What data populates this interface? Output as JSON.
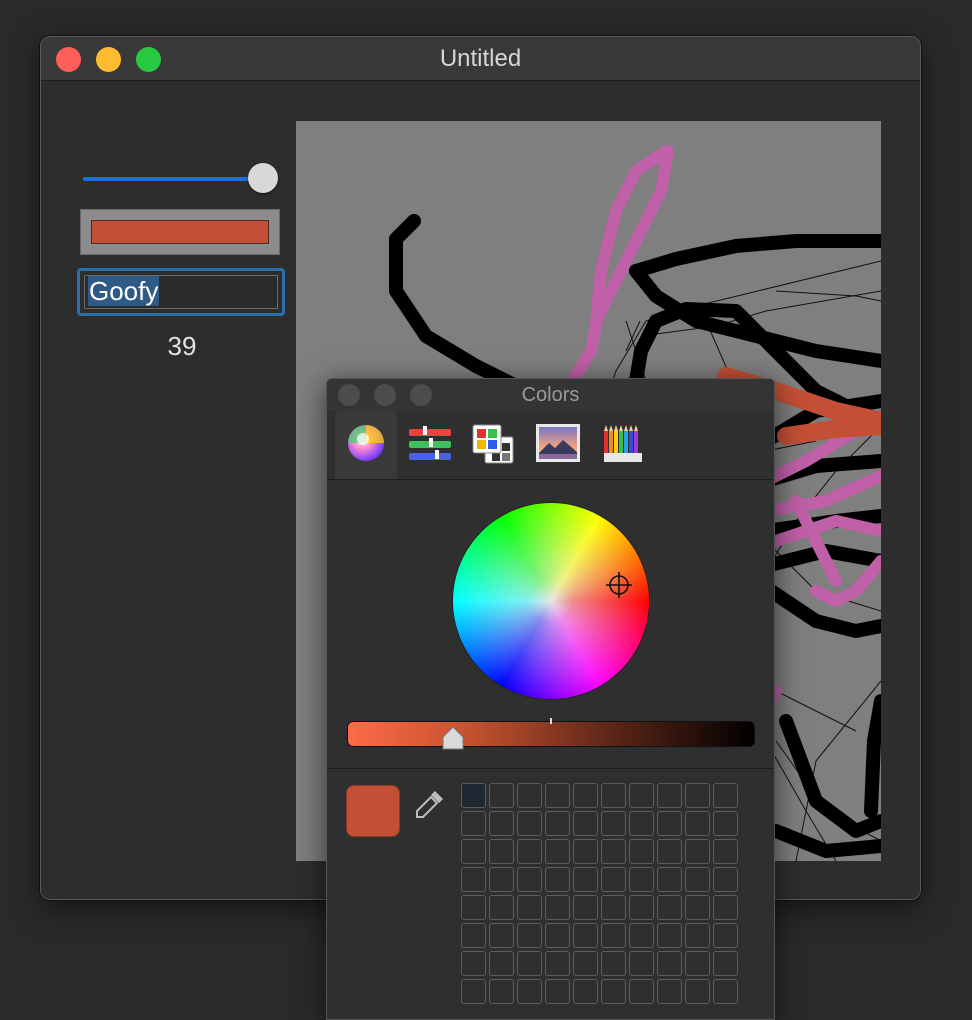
{
  "window": {
    "title": "Untitled"
  },
  "controls": {
    "slider_value_fraction": 1.0,
    "color_well_color": "#c44f35",
    "text_field_value": "Goofy",
    "number_label": "39"
  },
  "colors_panel": {
    "title": "Colors",
    "tabs": [
      {
        "name": "color-wheel",
        "active": true
      },
      {
        "name": "color-sliders",
        "active": false
      },
      {
        "name": "color-palettes",
        "active": false
      },
      {
        "name": "image-palettes",
        "active": false
      },
      {
        "name": "pencils",
        "active": false
      }
    ],
    "current_color": "#c44f35",
    "brightness_fraction": 0.26
  },
  "colors": {
    "accent": "#1b6fe0",
    "selection": "#2f5a86",
    "canvas_bg": "#7f7f7f",
    "pink_stroke": "#c060a8",
    "orange_stroke": "#c44f35"
  }
}
